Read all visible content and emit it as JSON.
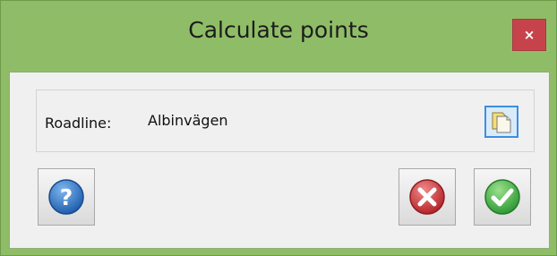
{
  "window": {
    "title": "Calculate points",
    "close_glyph": "×"
  },
  "form": {
    "roadline_label": "Roadline:",
    "roadline_value": "Albinvägen"
  },
  "icons": {
    "pick": "documents-icon",
    "help": "help-icon",
    "cancel": "cancel-icon",
    "ok": "check-icon"
  },
  "colors": {
    "frame": "#8fbd67",
    "close": "#c7434b",
    "help": "#2a73c8",
    "cancel": "#d63b3f",
    "ok": "#49b54a"
  }
}
